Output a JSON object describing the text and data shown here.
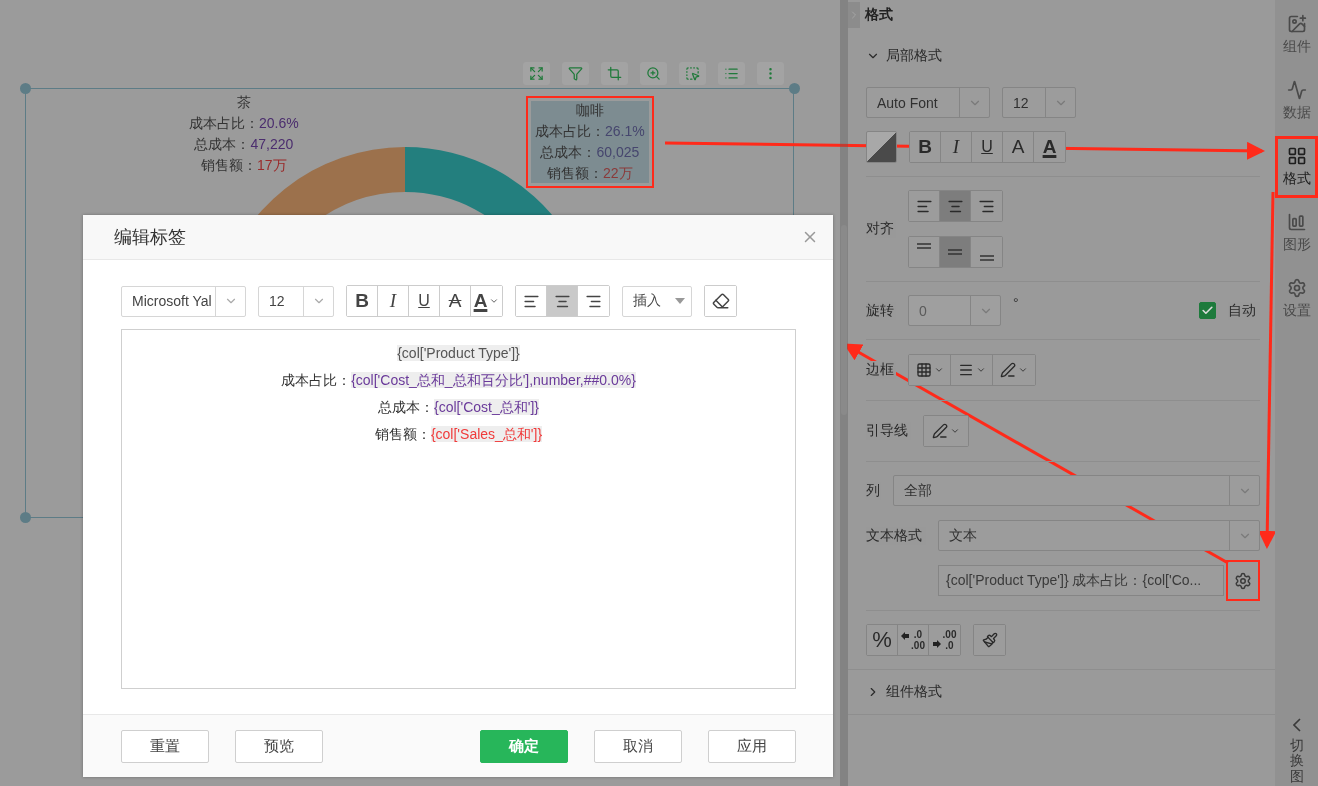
{
  "chart": {
    "labels": [
      {
        "title": "茶",
        "selected": false,
        "highlighted": false,
        "lines": [
          {
            "label": "成本占比：",
            "value": "20.6%",
            "color": "#4b2d6e"
          },
          {
            "label": "总成本：",
            "value": "47,220",
            "color": "#4b2d6e"
          },
          {
            "label": "销售额：",
            "value": "17万",
            "color": "#9a2a2a"
          }
        ]
      },
      {
        "title": "咖啡",
        "selected": true,
        "highlighted": true,
        "lines": [
          {
            "label": "成本占比：",
            "value": "26.1%",
            "color": "#46466e"
          },
          {
            "label": "总成本：",
            "value": "60,025",
            "color": "#46466e"
          },
          {
            "label": "销售额：",
            "value": "22万",
            "color": "#8a3a3a"
          }
        ]
      }
    ]
  },
  "panel": {
    "title": "格式",
    "sections": [
      {
        "title": "局部格式",
        "expanded": true
      },
      {
        "title": "组件格式",
        "expanded": false
      }
    ],
    "font": "Auto Font",
    "size": "12",
    "styles": [
      {
        "text": "B",
        "kind": "bold"
      },
      {
        "text": "I",
        "kind": "italic"
      },
      {
        "text": "U",
        "kind": "underline"
      },
      {
        "text": "A",
        "kind": "plain"
      },
      {
        "text": "A",
        "kind": "color"
      }
    ],
    "align_label": "对齐",
    "h_align": [
      {
        "selected": false
      },
      {
        "selected": true
      },
      {
        "selected": false
      }
    ],
    "v_align": [
      {
        "selected": false
      },
      {
        "selected": true
      },
      {
        "selected": false
      }
    ],
    "rotate_label": "旋转",
    "rotate_value": "0",
    "rotate_disabled": true,
    "degree": "°",
    "auto": {
      "label": "自动",
      "checked": true
    },
    "border_label": "边框",
    "leader_label": "引导线",
    "column_label": "列",
    "column_value": "全部",
    "text_format_label": "文本格式",
    "text_format_value": "文本",
    "format_string": "{col['Product Type']} 成本占比：{col['Co...",
    "gear_highlighted": true,
    "percent": "%",
    "decimals": [
      {
        "top": ".0",
        "bottom": ".00",
        "kind": "add"
      },
      {
        "top": ".00",
        "bottom": ".0",
        "kind": "remove"
      }
    ]
  },
  "rail": {
    "items": [
      {
        "label": "组件",
        "kind": "component",
        "selected": false,
        "highlighted": false
      },
      {
        "label": "数据",
        "kind": "data",
        "selected": false,
        "highlighted": false
      },
      {
        "label": "格式",
        "kind": "format",
        "selected": true,
        "highlighted": true
      },
      {
        "label": "图形",
        "kind": "graph",
        "selected": false,
        "highlighted": false
      },
      {
        "label": "设置",
        "kind": "settings",
        "selected": false,
        "highlighted": false
      }
    ],
    "switch_label": "切换图"
  },
  "dialog": {
    "title": "编辑标签",
    "font": "Microsoft Yal",
    "size": "12",
    "styles": [
      {
        "text": "B",
        "kind": "bold"
      },
      {
        "text": "I",
        "kind": "italic"
      },
      {
        "text": "U",
        "kind": "underline"
      },
      {
        "text": "A",
        "kind": "strike"
      },
      {
        "text": "A",
        "kind": "color"
      }
    ],
    "h_align": [
      {
        "selected": false
      },
      {
        "selected": true
      },
      {
        "selected": false
      }
    ],
    "insert": "插入",
    "lines": [
      {
        "token": "{col['Product Type']}",
        "color": "#555555"
      },
      {
        "label": "成本占比：",
        "token": "{col['Cost_总和_总和百分比'],number,##0.0%}",
        "color": "#6a3a9a"
      },
      {
        "label": "总成本：",
        "token": "{col['Cost_总和']}",
        "color": "#6a3a9a"
      },
      {
        "label": "销售额：",
        "token": "{col['Sales_总和']}",
        "color": "#f03a3a"
      }
    ],
    "buttons": [
      {
        "label": "重置",
        "kind": "default"
      },
      {
        "label": "预览",
        "kind": "default"
      },
      {
        "label": "确定",
        "kind": "primary"
      },
      {
        "label": "取消",
        "kind": "default"
      },
      {
        "label": "应用",
        "kind": "default"
      }
    ]
  }
}
